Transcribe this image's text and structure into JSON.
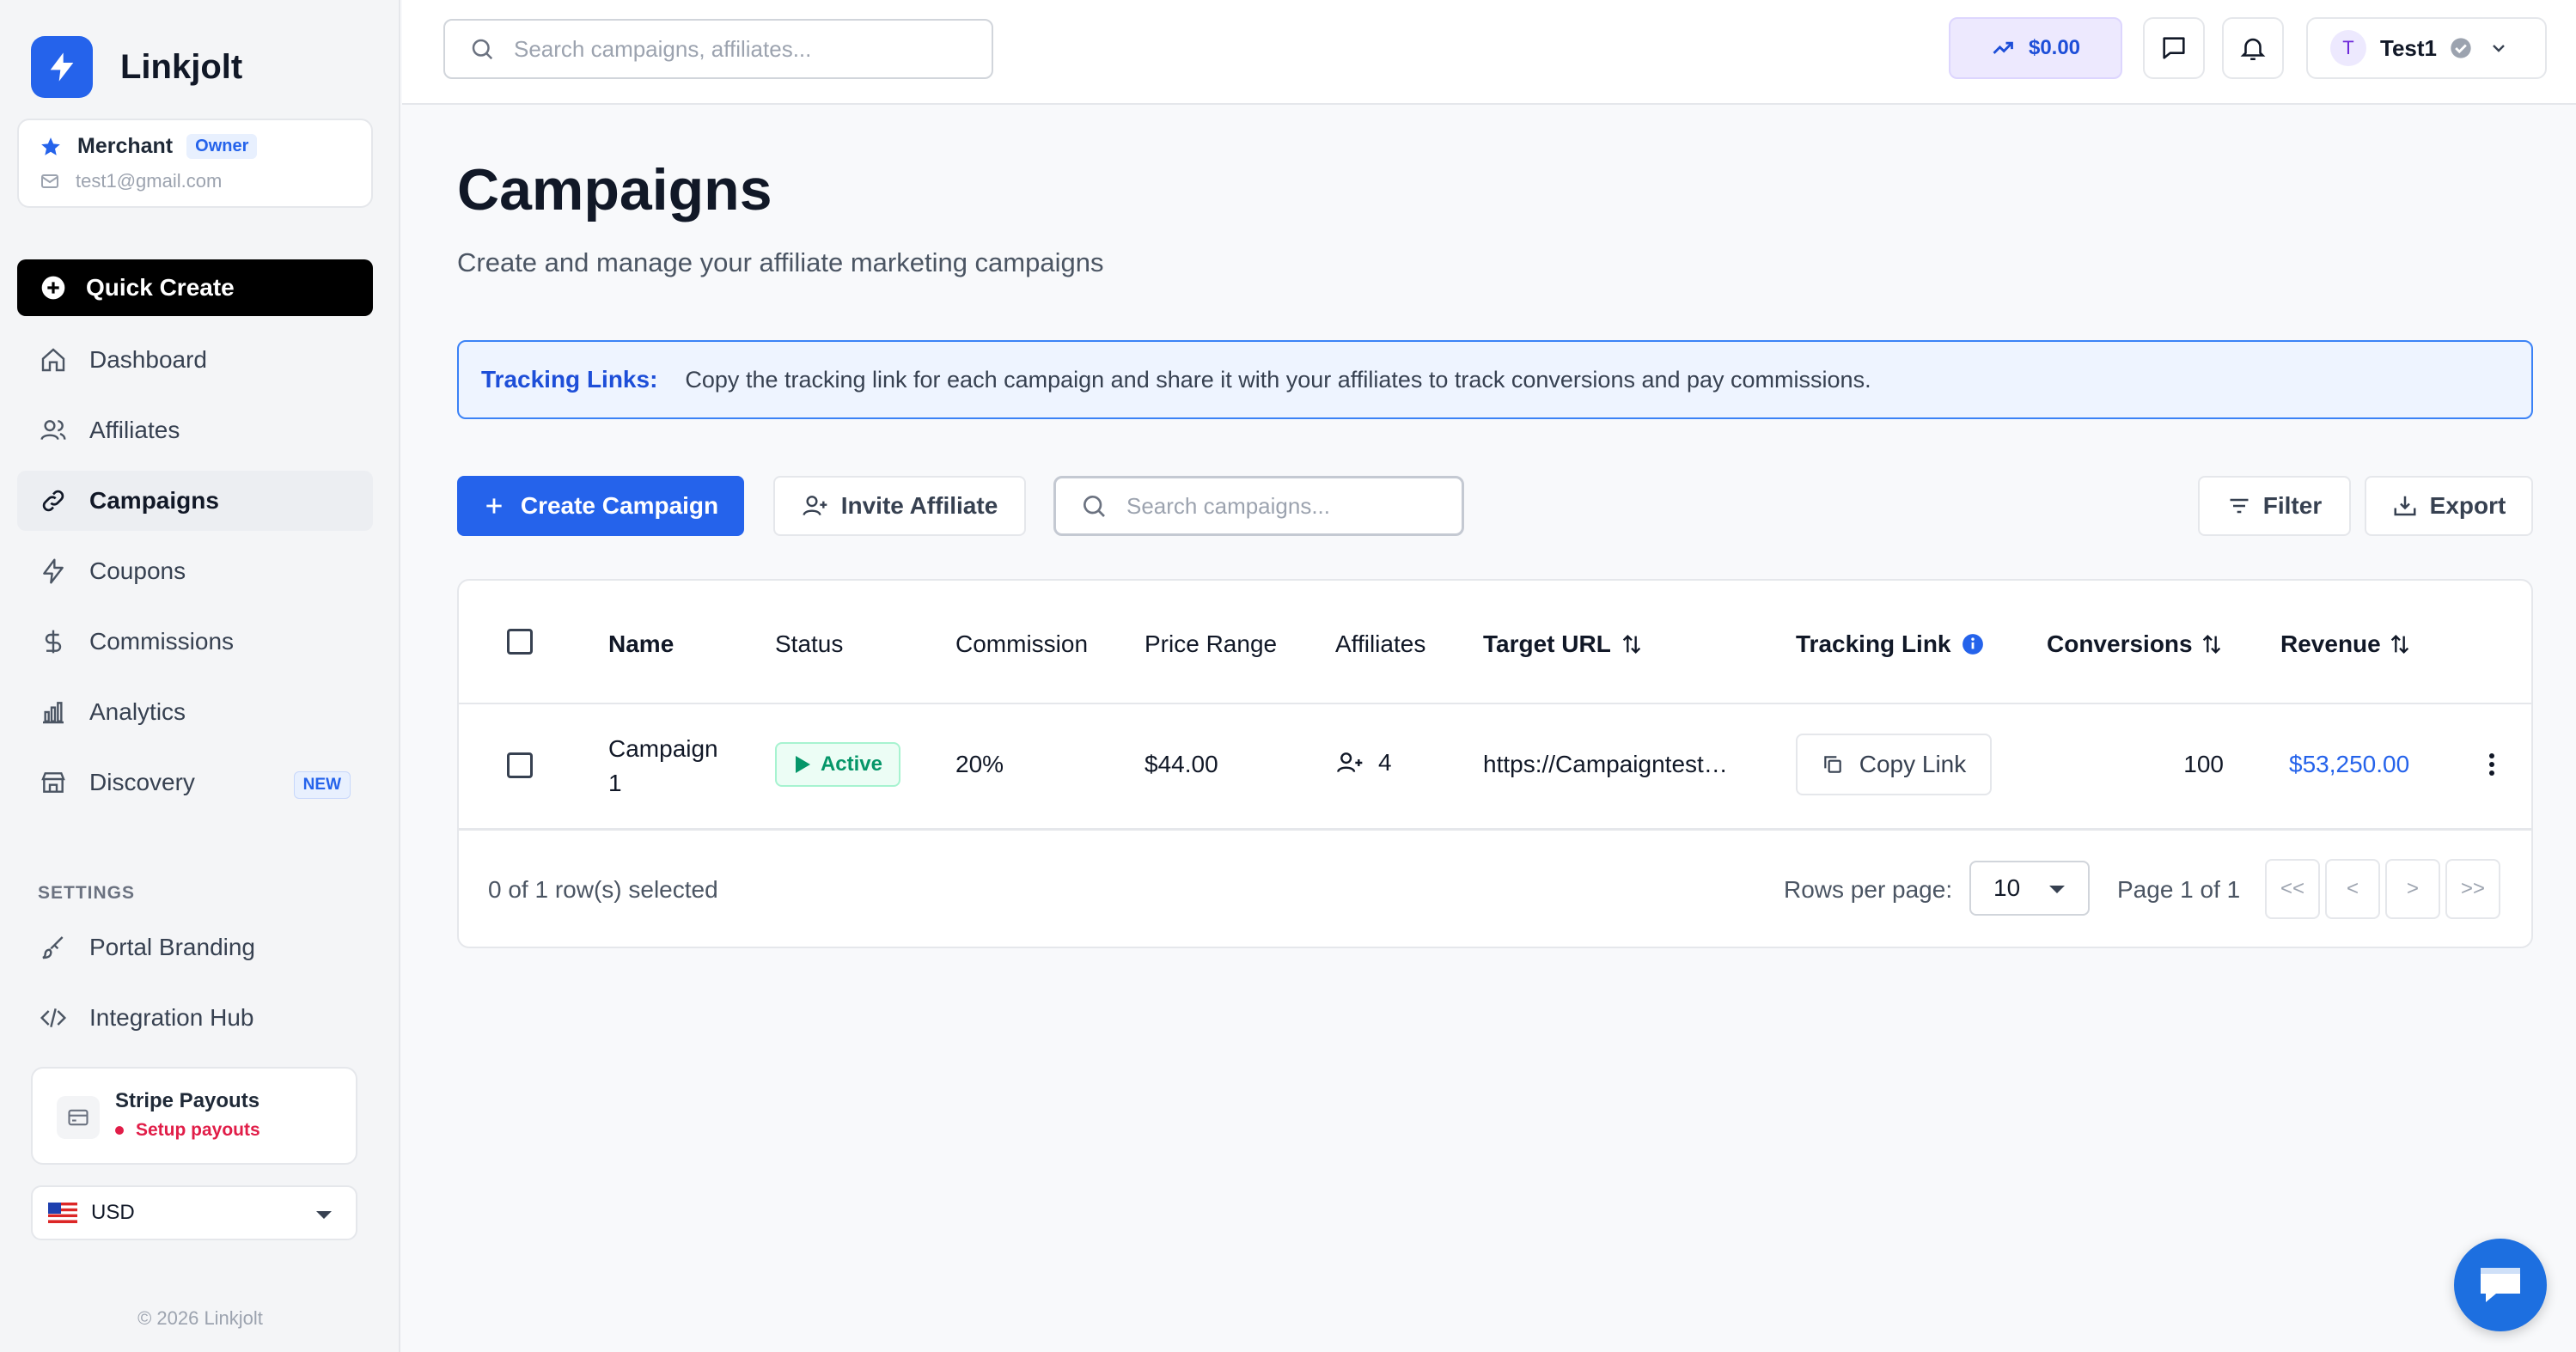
{
  "brand": {
    "name": "Linkjolt"
  },
  "account": {
    "role": "Merchant",
    "badge": "Owner",
    "email": "test1@gmail.com"
  },
  "sidebar": {
    "quick_create": "Quick Create",
    "items": [
      {
        "label": "Dashboard",
        "icon": "home-icon"
      },
      {
        "label": "Affiliates",
        "icon": "users-icon"
      },
      {
        "label": "Campaigns",
        "icon": "link-icon",
        "active": true
      },
      {
        "label": "Coupons",
        "icon": "bolt-icon"
      },
      {
        "label": "Commissions",
        "icon": "dollar-icon"
      },
      {
        "label": "Analytics",
        "icon": "bar-chart-icon"
      },
      {
        "label": "Discovery",
        "icon": "store-icon",
        "badge": "NEW"
      }
    ],
    "settings_heading": "SETTINGS",
    "settings_items": [
      {
        "label": "Portal Branding",
        "icon": "brush-icon"
      },
      {
        "label": "Integration Hub",
        "icon": "code-icon"
      }
    ],
    "stripe": {
      "title": "Stripe Payouts",
      "status": "Setup payouts"
    },
    "currency": {
      "flag": "us-flag-icon",
      "value": "USD"
    },
    "copyright": "© 2026 Linkjolt"
  },
  "topbar": {
    "search_placeholder": "Search campaigns, affiliates...",
    "balance": "$0.00",
    "user": {
      "initial": "T",
      "name": "Test1"
    }
  },
  "page": {
    "title": "Campaigns",
    "subtitle": "Create and manage your affiliate marketing campaigns"
  },
  "info": {
    "label": "Tracking Links:",
    "text": "Copy the tracking link for each campaign and share it with your affiliates to track conversions and pay commissions."
  },
  "toolbar": {
    "create_label": "Create Campaign",
    "invite_label": "Invite Affiliate",
    "search_placeholder": "Search campaigns...",
    "filter_label": "Filter",
    "export_label": "Export"
  },
  "table": {
    "columns": {
      "name": "Name",
      "status": "Status",
      "commission": "Commission",
      "price_range": "Price Range",
      "affiliates": "Affiliates",
      "target_url": "Target URL",
      "tracking_link": "Tracking Link",
      "conversions": "Conversions",
      "revenue": "Revenue"
    },
    "rows": [
      {
        "name_line1": "Campaign",
        "name_line2": "1",
        "status": "Active",
        "commission": "20%",
        "price_range": "$44.00",
        "affiliates": "4",
        "target_url": "https://Campaigntest…",
        "tracking_link": "Copy Link",
        "conversions": "100",
        "revenue": "$53,250.00"
      }
    ],
    "footer": {
      "selected": "0 of 1 row(s) selected",
      "rows_per_page_label": "Rows per page:",
      "rows_per_page": "10",
      "page_info": "Page 1 of 1",
      "first": "<<",
      "prev": "<",
      "next": ">",
      "last": ">>"
    }
  },
  "colors": {
    "accent": "#2563eb",
    "active_green": "#059669",
    "alert_red": "#e11d48"
  }
}
